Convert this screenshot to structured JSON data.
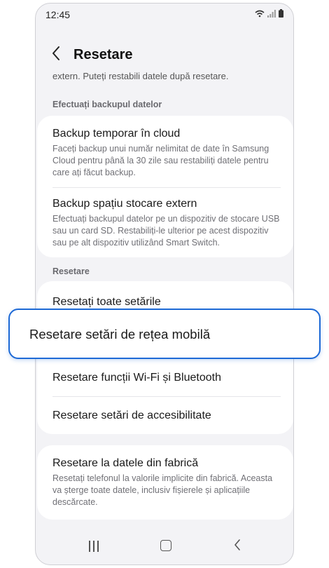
{
  "status_bar": {
    "time": "12:45",
    "icons": "wifi-icon signal-icon battery-icon"
  },
  "header": {
    "title": "Resetare"
  },
  "top_cut_text": "extern. Puteți restabili datele după resetare.",
  "sections": {
    "backup": {
      "label": "Efectuați backupul datelor",
      "items": [
        {
          "title": "Backup temporar în cloud",
          "desc": "Faceți backup unui număr nelimitat de date în Samsung Cloud pentru până la 30 zile sau restabiliți datele pentru care ați făcut backup."
        },
        {
          "title": "Backup spațiu stocare extern",
          "desc": "Efectuați backupul datelor pe un dispozitiv de stocare USB sau un card SD. Restabiliți-le ulterior pe acest dispozitiv sau pe alt dispozitiv utilizând Smart Switch."
        }
      ]
    },
    "reset": {
      "label": "Resetare",
      "items": [
        {
          "title": "Resetați toate setările"
        },
        {
          "title": "Resetare setări de rețea mobilă"
        },
        {
          "title": "Resetare funcții Wi-Fi și Bluetooth"
        },
        {
          "title": "Resetare setări de accesibilitate"
        }
      ]
    },
    "factory": {
      "title": "Resetare la datele din fabrică",
      "desc": "Resetați telefonul la valorile implicite din fabrică. Aceasta va șterge toate datele, inclusiv fișierele și aplicațiile descărcate."
    }
  },
  "colors": {
    "accent": "#1e6ad6",
    "background": "#f3f3f6"
  }
}
